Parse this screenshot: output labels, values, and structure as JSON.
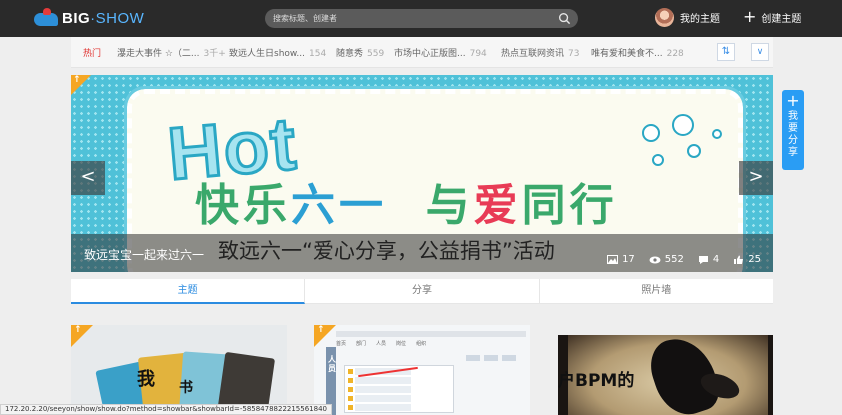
{
  "header": {
    "logo_text_main": "BIG",
    "logo_text_dot": "·",
    "logo_text_sub": "SHOW",
    "search_placeholder": "搜索标题、创建者",
    "my_topics": "我的主题",
    "create_topic": "创建主题"
  },
  "hotbar": {
    "items": [
      {
        "label": "热门",
        "count": ""
      },
      {
        "label": "瀑走大事件 ☆（二...",
        "count": "3千+"
      },
      {
        "label": "致远人生日show...",
        "count": "154"
      },
      {
        "label": "随意秀",
        "count": "559"
      },
      {
        "label": "市场中心正版图...",
        "count": "794"
      },
      {
        "label": "热点互联网资讯",
        "count": "73"
      },
      {
        "label": "唯有爱和美食不...",
        "count": "228"
      }
    ]
  },
  "banner": {
    "hot_word": "Hot",
    "headline_1": "快乐",
    "headline_2": "六一",
    "headline_3": "与",
    "headline_4": "爱",
    "headline_5": "同行",
    "caption": "致远宝宝一起来过六一",
    "overlay_title": "致远六一“爱心分享，公益捐书”活动",
    "stats": {
      "images": "17",
      "views": "552",
      "comments": "4",
      "likes": "25"
    },
    "prev": "<",
    "next": ">"
  },
  "share_widget": {
    "plus": "+",
    "label": "我要分享"
  },
  "tabs": [
    "主题",
    "分享",
    "照片墙"
  ],
  "cards": {
    "card1_glyphs": [
      "我",
      "书"
    ],
    "card2_tabs": [
      "首页",
      "部门",
      "人员",
      "岗位",
      "组织"
    ],
    "card2_side_text": "人员",
    "card3_text": "户BPM的"
  },
  "status_bar": "172.20.2.20/seeyon/show/show.do?method=showbar&showbarId=-5858478822215561840",
  "colors": {
    "header_bg": "#2a2a2a",
    "accent_blue": "#2a8be0",
    "hot_red": "#e0312f",
    "ribbon_orange": "#f5a623"
  }
}
